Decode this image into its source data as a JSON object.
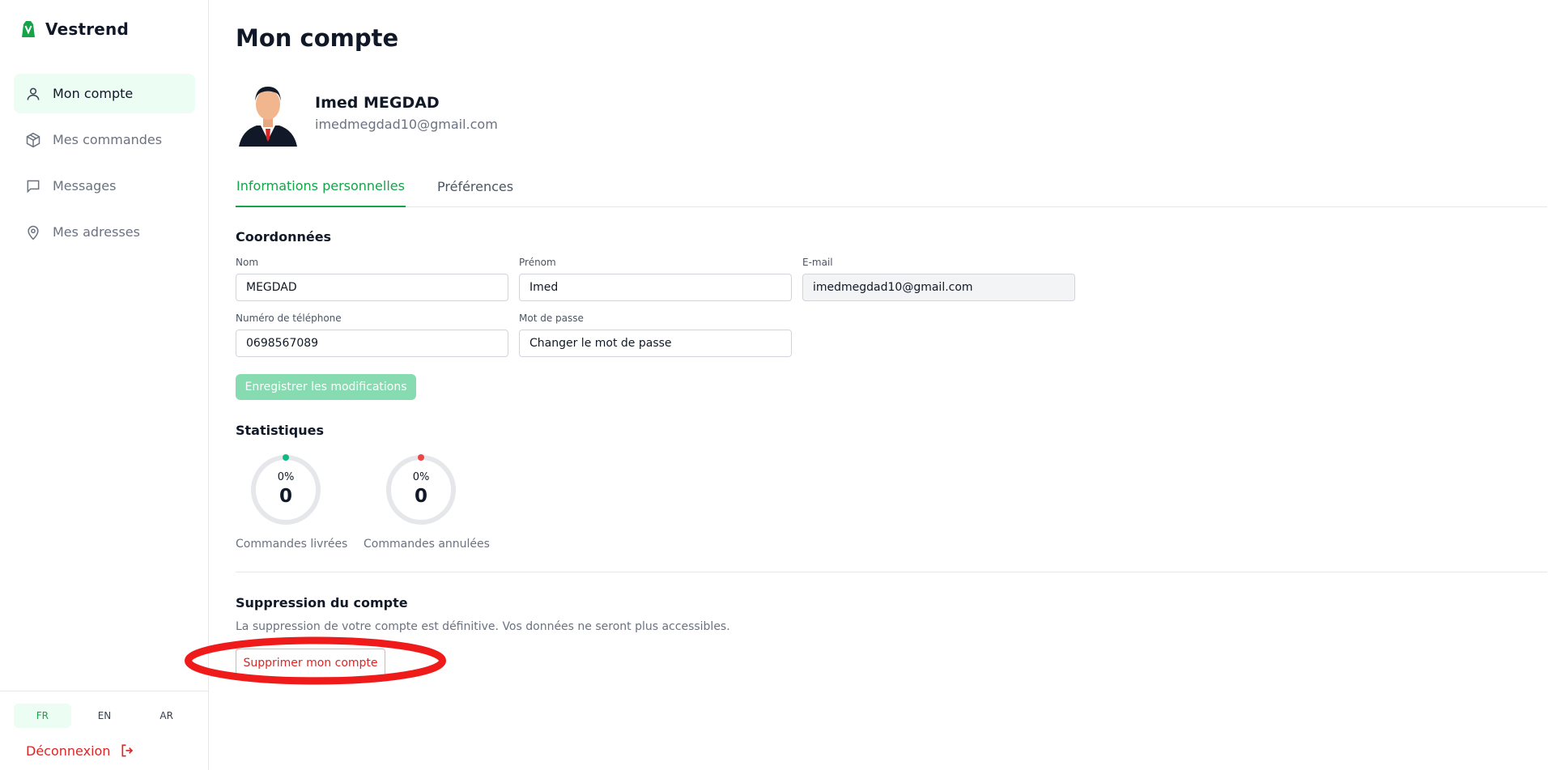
{
  "app": {
    "name": "Vestrend",
    "brand_color": "#16a34a",
    "danger_color": "#dc2626"
  },
  "sidebar": {
    "items": [
      {
        "label": "Mon compte",
        "icon": "user-icon",
        "active": true
      },
      {
        "label": "Mes commandes",
        "icon": "package-icon",
        "active": false
      },
      {
        "label": "Messages",
        "icon": "message-icon",
        "active": false
      },
      {
        "label": "Mes adresses",
        "icon": "map-pin-icon",
        "active": false
      }
    ],
    "languages": [
      {
        "code": "FR",
        "active": true
      },
      {
        "code": "EN",
        "active": false
      },
      {
        "code": "AR",
        "active": false
      }
    ],
    "logout_label": "Déconnexion"
  },
  "page": {
    "title": "Mon compte"
  },
  "profile": {
    "name": "Imed MEGDAD",
    "email": "imedmegdad10@gmail.com"
  },
  "tabs": [
    {
      "label": "Informations personnelles",
      "active": true
    },
    {
      "label": "Préférences",
      "active": false
    }
  ],
  "coordinates": {
    "title": "Coordonnées",
    "fields": {
      "nom": {
        "label": "Nom",
        "value": "MEGDAD"
      },
      "prenom": {
        "label": "Prénom",
        "value": "Imed"
      },
      "email": {
        "label": "E-mail",
        "value": "imedmegdad10@gmail.com"
      },
      "telephone": {
        "label": "Numéro de téléphone",
        "value": "0698567089"
      },
      "password": {
        "label": "Mot de passe",
        "value": "Changer le mot de passe"
      }
    },
    "save_label": "Enregistrer les modifications"
  },
  "statistics": {
    "title": "Statistiques",
    "items": [
      {
        "percent": "0%",
        "value": "0",
        "label": "Commandes livrées",
        "color": "#10b981"
      },
      {
        "percent": "0%",
        "value": "0",
        "label": "Commandes annulées",
        "color": "#ef4444"
      }
    ]
  },
  "account_deletion": {
    "title": "Suppression du compte",
    "description": "La suppression de votre compte est définitive. Vos données ne seront plus accessibles.",
    "button_label": "Supprimer mon compte"
  }
}
